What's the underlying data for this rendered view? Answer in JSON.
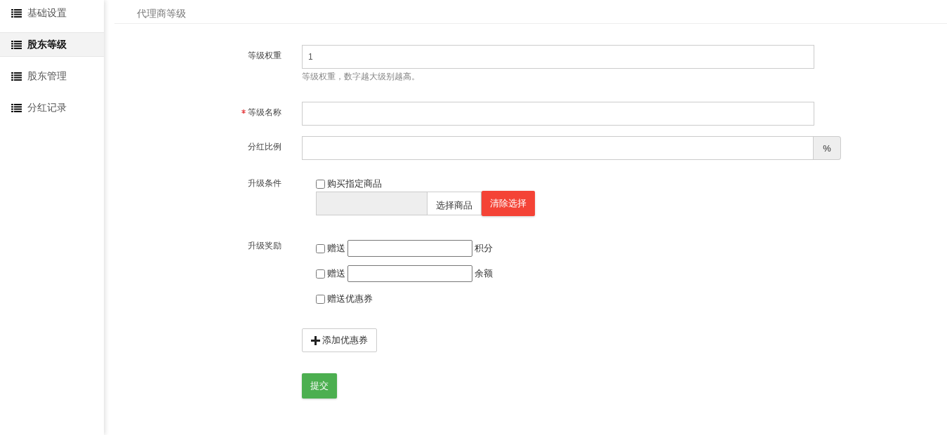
{
  "sidebar": {
    "items": [
      {
        "label": "基础设置",
        "selected": false
      },
      {
        "label": "股东等级",
        "selected": true
      },
      {
        "label": "股东管理",
        "selected": false
      },
      {
        "label": "分红记录",
        "selected": false
      }
    ]
  },
  "page_title": "代理商等级",
  "fields": [
    {
      "label": "等级权重",
      "required": false,
      "value": "1",
      "help": "等级权重，数字越大级别越高。"
    },
    {
      "label": "等级名称",
      "required": true
    },
    {
      "label": "分红比例",
      "required": false,
      "suffix": "%"
    }
  ],
  "upgrade_condition": {
    "label": "升级条件",
    "option": {
      "label": "购买指定商品",
      "checked": false
    },
    "select_button": "选择商品",
    "clear_button": "清除选择"
  },
  "upgrade_rewards": {
    "label": "升级奖励",
    "items": [
      {
        "kind": "amount",
        "prefix": "赠送",
        "unit": "积分",
        "checked": false
      },
      {
        "kind": "amount",
        "prefix": "赠送",
        "unit": "余额",
        "checked": false
      },
      {
        "kind": "plain",
        "label": "赠送优惠券",
        "checked": false
      }
    ]
  },
  "add_coupon_button": "添加优惠券",
  "submit_button": "提交"
}
